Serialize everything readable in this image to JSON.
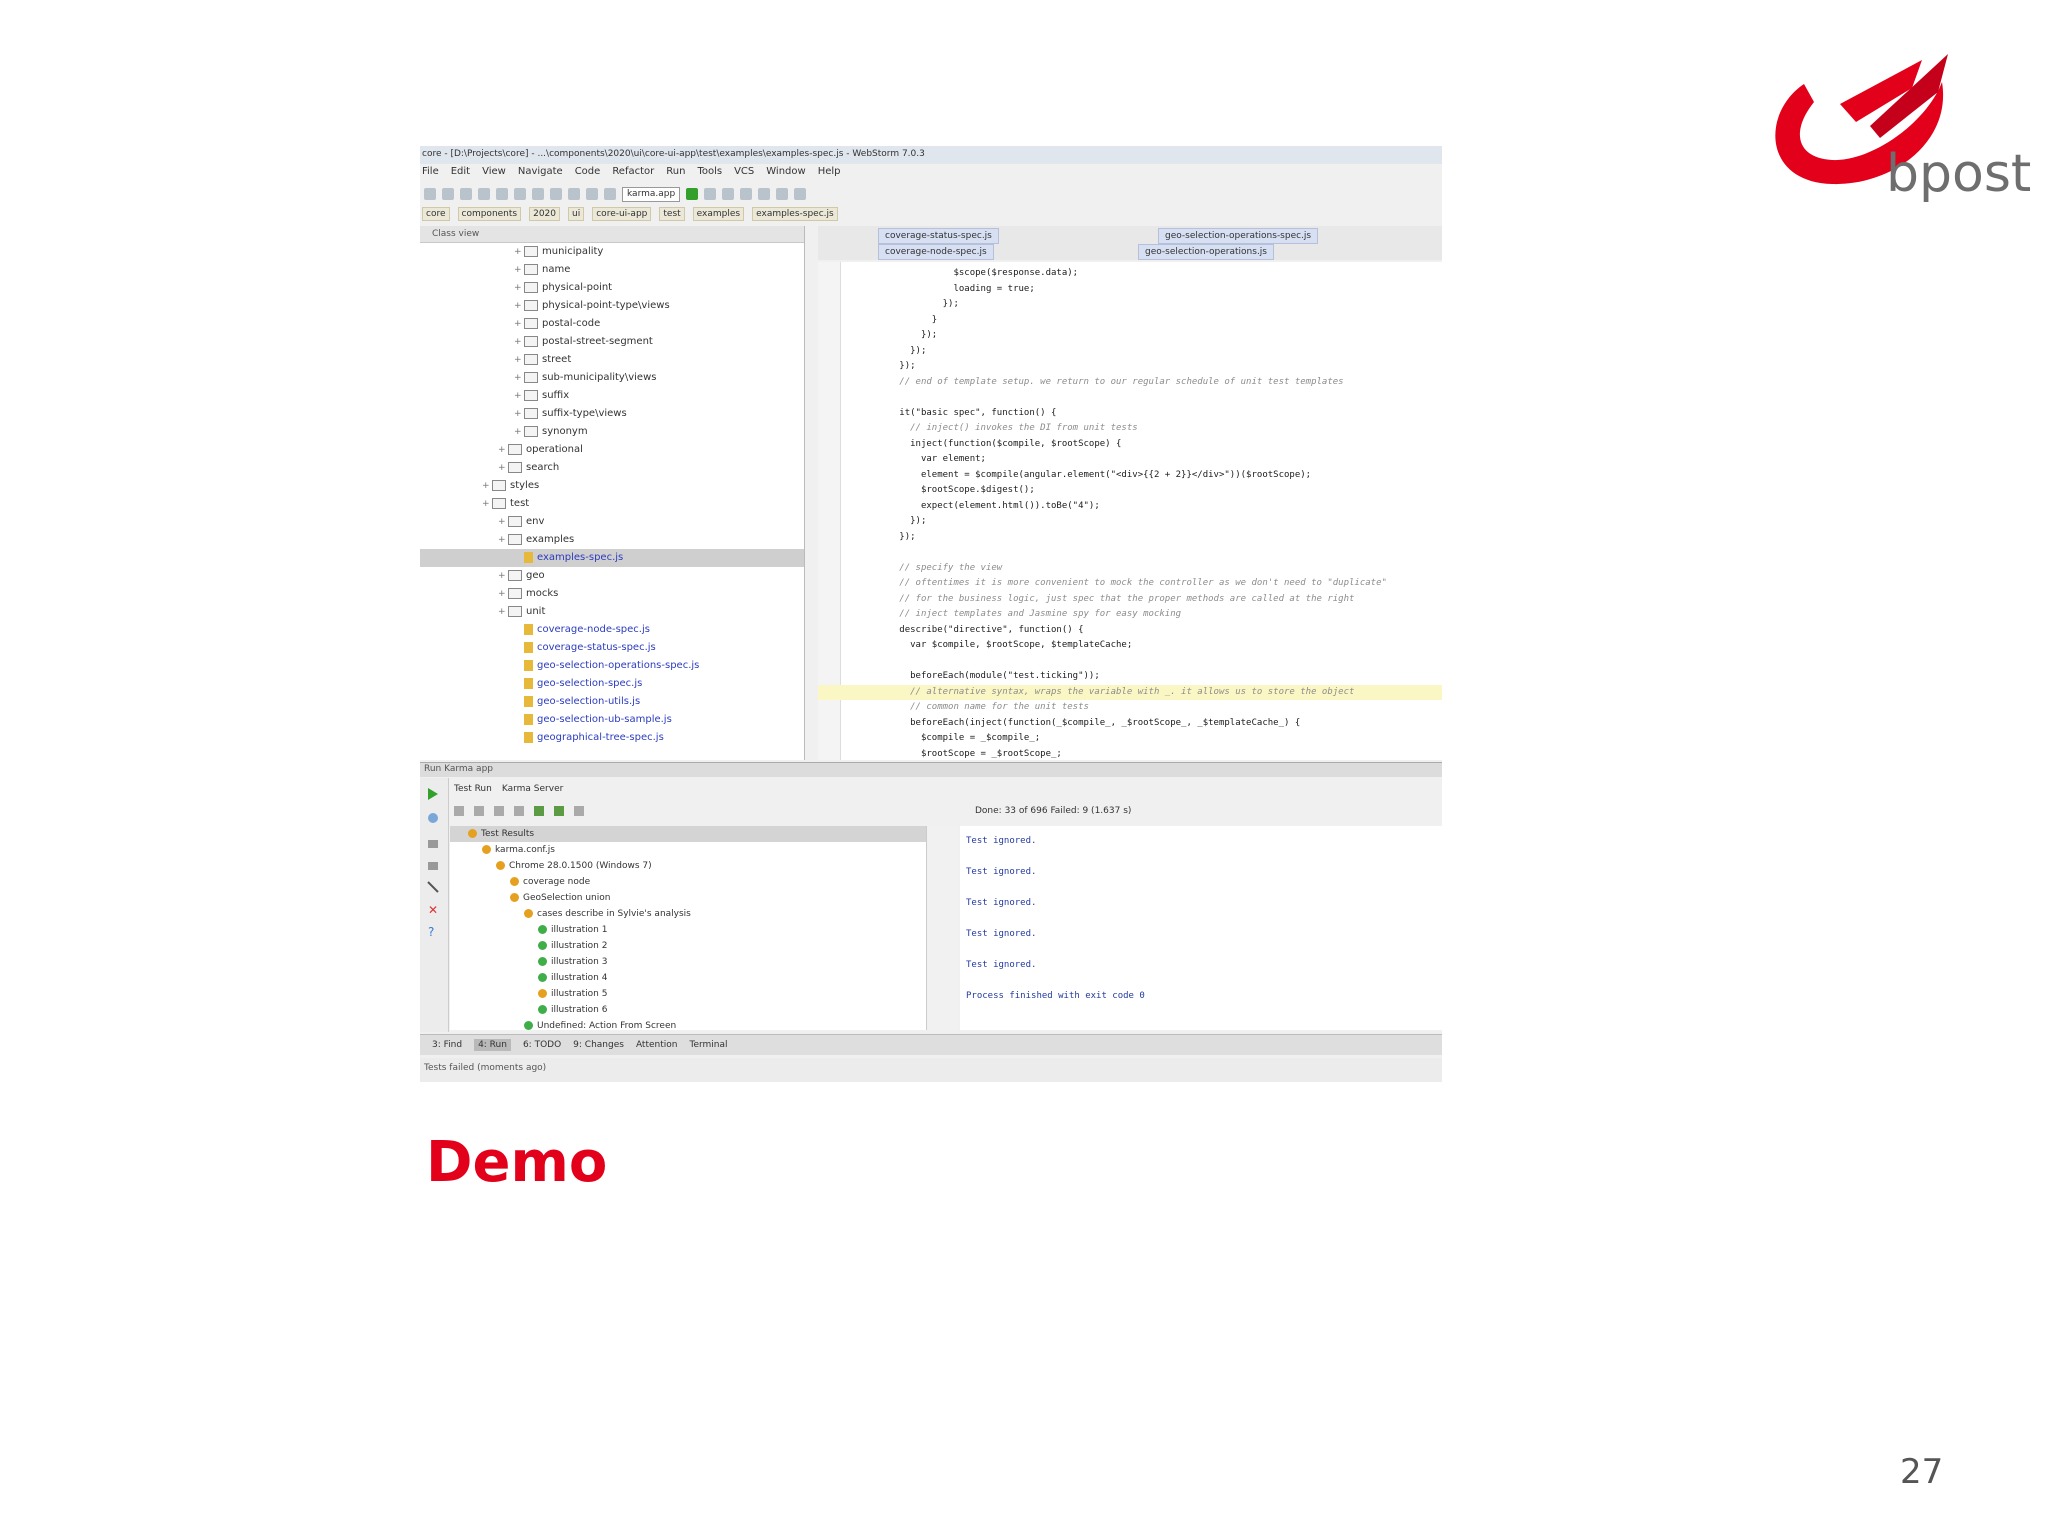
{
  "slide": {
    "title": "Demo",
    "page_number": "27",
    "logo_text": "bpost",
    "colors": {
      "accent": "#e3001b",
      "logo_gray": "#6e6e6e"
    }
  },
  "ide": {
    "window_title": "core - [D:\\Projects\\core] - ...\\components\\2020\\ui\\core-ui-app\\test\\examples\\examples-spec.js - WebStorm 7.0.3",
    "menu": [
      "File",
      "Edit",
      "View",
      "Navigate",
      "Code",
      "Refactor",
      "Run",
      "Tools",
      "VCS",
      "Window",
      "Help"
    ],
    "run_config": "karma.app",
    "breadcrumbs": [
      "core",
      "components",
      "2020",
      "ui",
      "core-ui-app",
      "test",
      "examples",
      "examples-spec.js"
    ],
    "project_header": "Class view",
    "tree": [
      {
        "label": "municipality",
        "type": "folder",
        "indent": 4
      },
      {
        "label": "name",
        "type": "folder",
        "indent": 4
      },
      {
        "label": "physical-point",
        "type": "folder",
        "indent": 4
      },
      {
        "label": "physical-point-type\\views",
        "type": "folder",
        "indent": 4
      },
      {
        "label": "postal-code",
        "type": "folder",
        "indent": 4
      },
      {
        "label": "postal-street-segment",
        "type": "folder",
        "indent": 4
      },
      {
        "label": "street",
        "type": "folder",
        "indent": 4
      },
      {
        "label": "sub-municipality\\views",
        "type": "folder",
        "indent": 4
      },
      {
        "label": "suffix",
        "type": "folder",
        "indent": 4
      },
      {
        "label": "suffix-type\\views",
        "type": "folder",
        "indent": 4
      },
      {
        "label": "synonym",
        "type": "folder",
        "indent": 4
      },
      {
        "label": "operational",
        "type": "folder",
        "indent": 3
      },
      {
        "label": "search",
        "type": "folder",
        "indent": 3
      },
      {
        "label": "styles",
        "type": "folder",
        "indent": 2
      },
      {
        "label": "test",
        "type": "folder",
        "indent": 2
      },
      {
        "label": "env",
        "type": "folder",
        "indent": 3
      },
      {
        "label": "examples",
        "type": "folder",
        "indent": 3
      },
      {
        "label": "examples-spec.js",
        "type": "js",
        "indent": 4,
        "selected": true
      },
      {
        "label": "geo",
        "type": "folder",
        "indent": 3
      },
      {
        "label": "mocks",
        "type": "folder",
        "indent": 3
      },
      {
        "label": "unit",
        "type": "folder",
        "indent": 3
      },
      {
        "label": "coverage-node-spec.js",
        "type": "js",
        "indent": 4
      },
      {
        "label": "coverage-status-spec.js",
        "type": "js",
        "indent": 4
      },
      {
        "label": "geo-selection-operations-spec.js",
        "type": "js",
        "indent": 4
      },
      {
        "label": "geo-selection-spec.js",
        "type": "js",
        "indent": 4
      },
      {
        "label": "geo-selection-utils.js",
        "type": "js",
        "indent": 4
      },
      {
        "label": "geo-selection-ub-sample.js",
        "type": "js",
        "indent": 4
      },
      {
        "label": "geographical-tree-spec.js",
        "type": "js",
        "indent": 4
      }
    ],
    "tabs_row1": [
      "coverage-status-spec.js",
      "geo-selection-operations-spec.js"
    ],
    "tabs_row2": [
      "coverage-node-spec.js",
      "geo-selection-operations.js"
    ],
    "code": [
      {
        "text": "                  $scope($response.data);",
        "kind": "code"
      },
      {
        "text": "                  loading = true;",
        "kind": "code"
      },
      {
        "text": "                });",
        "kind": "code"
      },
      {
        "text": "              }",
        "kind": "code"
      },
      {
        "text": "            });",
        "kind": "code"
      },
      {
        "text": "          });",
        "kind": "code"
      },
      {
        "text": "        });",
        "kind": "code"
      },
      {
        "text": "        // end of template setup. we return to our regular schedule of unit test templates",
        "kind": "comment"
      },
      {
        "text": "",
        "kind": "code"
      },
      {
        "text": "        it(\"basic spec\", function() {",
        "kind": "code"
      },
      {
        "text": "          // inject() invokes the DI from unit tests",
        "kind": "comment"
      },
      {
        "text": "          inject(function($compile, $rootScope) {",
        "kind": "code"
      },
      {
        "text": "            var element;",
        "kind": "code"
      },
      {
        "text": "            element = $compile(angular.element(\"<div>{{2 + 2}}</div>\"))($rootScope);",
        "kind": "code"
      },
      {
        "text": "            $rootScope.$digest();",
        "kind": "code"
      },
      {
        "text": "            expect(element.html()).toBe(\"4\");",
        "kind": "code"
      },
      {
        "text": "          });",
        "kind": "code"
      },
      {
        "text": "        });",
        "kind": "code"
      },
      {
        "text": "",
        "kind": "code"
      },
      {
        "text": "        // specify the view",
        "kind": "comment"
      },
      {
        "text": "        // oftentimes it is more convenient to mock the controller as we don't need to \"duplicate\"",
        "kind": "comment"
      },
      {
        "text": "        // for the business logic, just spec that the proper methods are called at the right",
        "kind": "comment"
      },
      {
        "text": "        // inject templates and Jasmine spy for easy mocking",
        "kind": "comment"
      },
      {
        "text": "        describe(\"directive\", function() {",
        "kind": "code"
      },
      {
        "text": "          var $compile, $rootScope, $templateCache;",
        "kind": "code"
      },
      {
        "text": "",
        "kind": "code"
      },
      {
        "text": "          beforeEach(module(\"test.ticking\"));",
        "kind": "code"
      },
      {
        "text": "          // alternative syntax, wraps the variable with _. it allows us to store the object",
        "kind": "comment",
        "highlight": true
      },
      {
        "text": "          // common name for the unit tests",
        "kind": "comment"
      },
      {
        "text": "          beforeEach(inject(function(_$compile_, _$rootScope_, _$templateCache_) {",
        "kind": "code"
      },
      {
        "text": "            $compile = _$compile_;",
        "kind": "code"
      },
      {
        "text": "            $rootScope = _$rootScope_;",
        "kind": "code"
      }
    ],
    "run_title": "Run  Karma app",
    "run_tabs": [
      "Test Run",
      "Karma Server"
    ],
    "done_text": "Done: 33 of 696  Failed: 9  (1.637 s)",
    "results": [
      {
        "label": "Test Results",
        "indent": 1,
        "color": "#e6a020",
        "selected": true
      },
      {
        "label": "karma.conf.js",
        "indent": 2,
        "color": "#e6a020"
      },
      {
        "label": "Chrome 28.0.1500 (Windows 7)",
        "indent": 3,
        "color": "#e6a020"
      },
      {
        "label": "coverage node",
        "indent": 4,
        "color": "#e6a020"
      },
      {
        "label": "GeoSelection union",
        "indent": 4,
        "color": "#e6a020"
      },
      {
        "label": "cases describe in Sylvie's analysis",
        "indent": 5,
        "color": "#e6a020"
      },
      {
        "label": "illustration 1",
        "indent": 6,
        "color": "#3fae49"
      },
      {
        "label": "illustration 2",
        "indent": 6,
        "color": "#3fae49"
      },
      {
        "label": "illustration 3",
        "indent": 6,
        "color": "#3fae49"
      },
      {
        "label": "illustration 4",
        "indent": 6,
        "color": "#3fae49"
      },
      {
        "label": "illustration 5",
        "indent": 6,
        "color": "#e6a020"
      },
      {
        "label": "illustration 6",
        "indent": 6,
        "color": "#3fae49"
      },
      {
        "label": "Undefined: Action From Screen",
        "indent": 5,
        "color": "#3fae49"
      }
    ],
    "console": [
      "Test ignored.",
      "Test ignored.",
      "Test ignored.",
      "Test ignored.",
      "Test ignored.",
      "Process finished with exit code 0"
    ],
    "bottom_tabs": [
      "3: Find",
      "4: Run",
      "6: TODO",
      "9: Changes",
      "Attention",
      "Terminal"
    ],
    "status": "Tests failed (moments ago)"
  }
}
